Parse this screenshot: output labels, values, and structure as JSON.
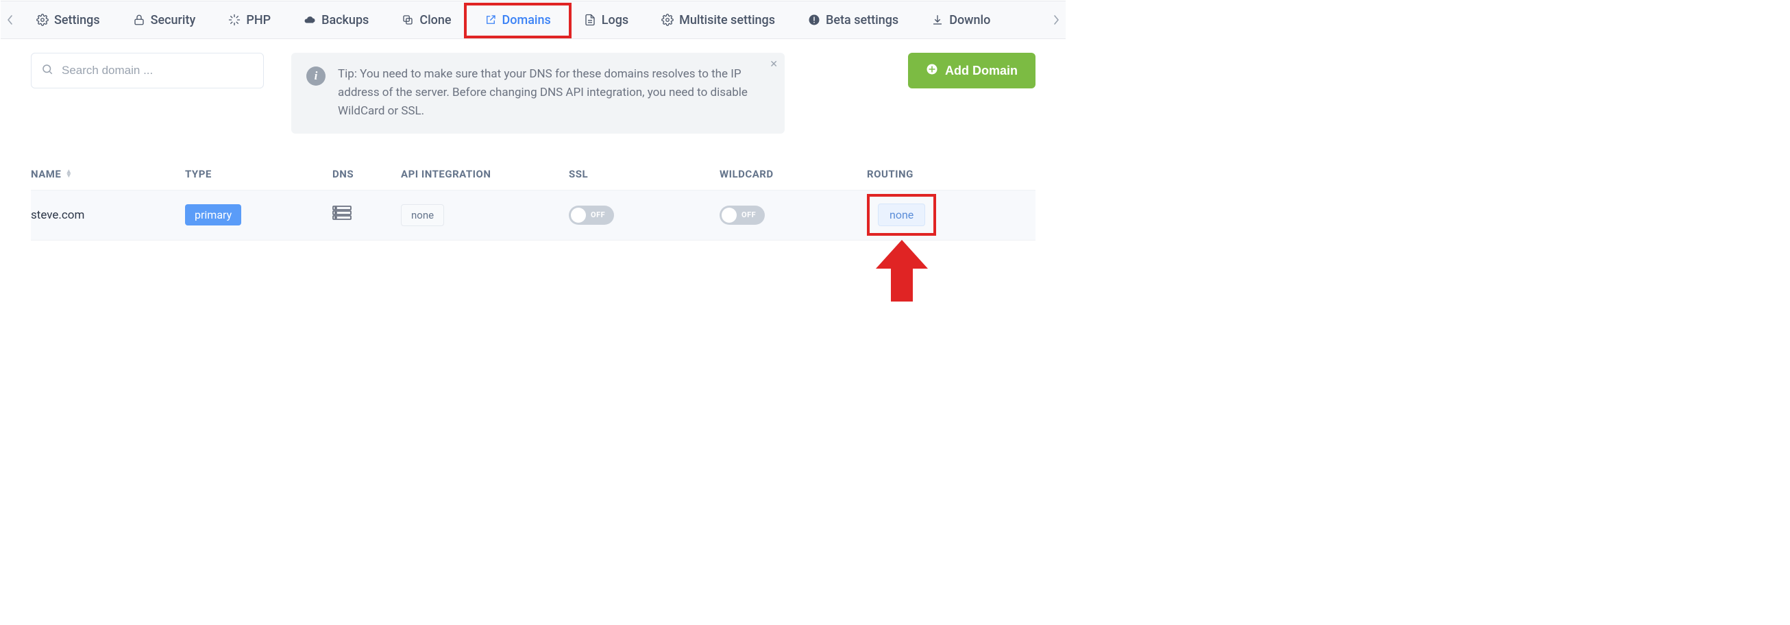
{
  "nav": {
    "items": [
      {
        "label": "Settings",
        "icon": "gear-icon"
      },
      {
        "label": "Security",
        "icon": "lock-icon"
      },
      {
        "label": "PHP",
        "icon": "loader-icon"
      },
      {
        "label": "Backups",
        "icon": "cloud-icon"
      },
      {
        "label": "Clone",
        "icon": "copy-icon"
      },
      {
        "label": "Domains",
        "icon": "external-link-icon",
        "active": true
      },
      {
        "label": "Logs",
        "icon": "file-text-icon"
      },
      {
        "label": "Multisite settings",
        "icon": "gear-icon"
      },
      {
        "label": "Beta settings",
        "icon": "alert-icon"
      },
      {
        "label": "Downlo",
        "icon": "download-icon"
      }
    ]
  },
  "search": {
    "placeholder": "Search domain ..."
  },
  "tip": {
    "text": "Tip: You need to make sure that your DNS for these domains resolves to the IP address of the server. Before changing DNS API integration, you need to disable WildCard or SSL."
  },
  "add_domain_label": "Add Domain",
  "table": {
    "headers": {
      "name": "NAME",
      "type": "TYPE",
      "dns": "DNS",
      "api": "API INTEGRATION",
      "ssl": "SSL",
      "wildcard": "WILDCARD",
      "routing": "ROUTING"
    },
    "rows": [
      {
        "name": "steve.com",
        "type_badge": "primary",
        "api_integration": "none",
        "ssl_label": "OFF",
        "ssl_on": false,
        "wildcard_label": "OFF",
        "wildcard_on": false,
        "routing": "none"
      }
    ]
  }
}
